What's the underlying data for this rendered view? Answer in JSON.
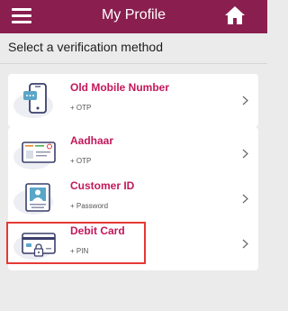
{
  "header": {
    "title": "My Profile",
    "menu_icon": "hamburger-menu-icon",
    "home_icon": "home-icon",
    "background_color": "#8a1f4f"
  },
  "prompt": "Select a verification method",
  "methods": [
    {
      "title": "Old Mobile Number",
      "subtitle": "+ OTP",
      "icon": "mobile-otp-icon"
    },
    {
      "title": "Aadhaar",
      "subtitle": "+ OTP",
      "icon": "aadhaar-card-icon"
    },
    {
      "title": "Customer ID",
      "subtitle": "+ Password",
      "icon": "id-card-icon"
    },
    {
      "title": "Debit Card",
      "subtitle": "+ PIN",
      "icon": "debit-card-lock-icon"
    }
  ],
  "highlighted_method": "Debit Card",
  "colors": {
    "accent": "#c2185b",
    "highlight_border": "#e53935",
    "page_background": "#ebebeb"
  }
}
